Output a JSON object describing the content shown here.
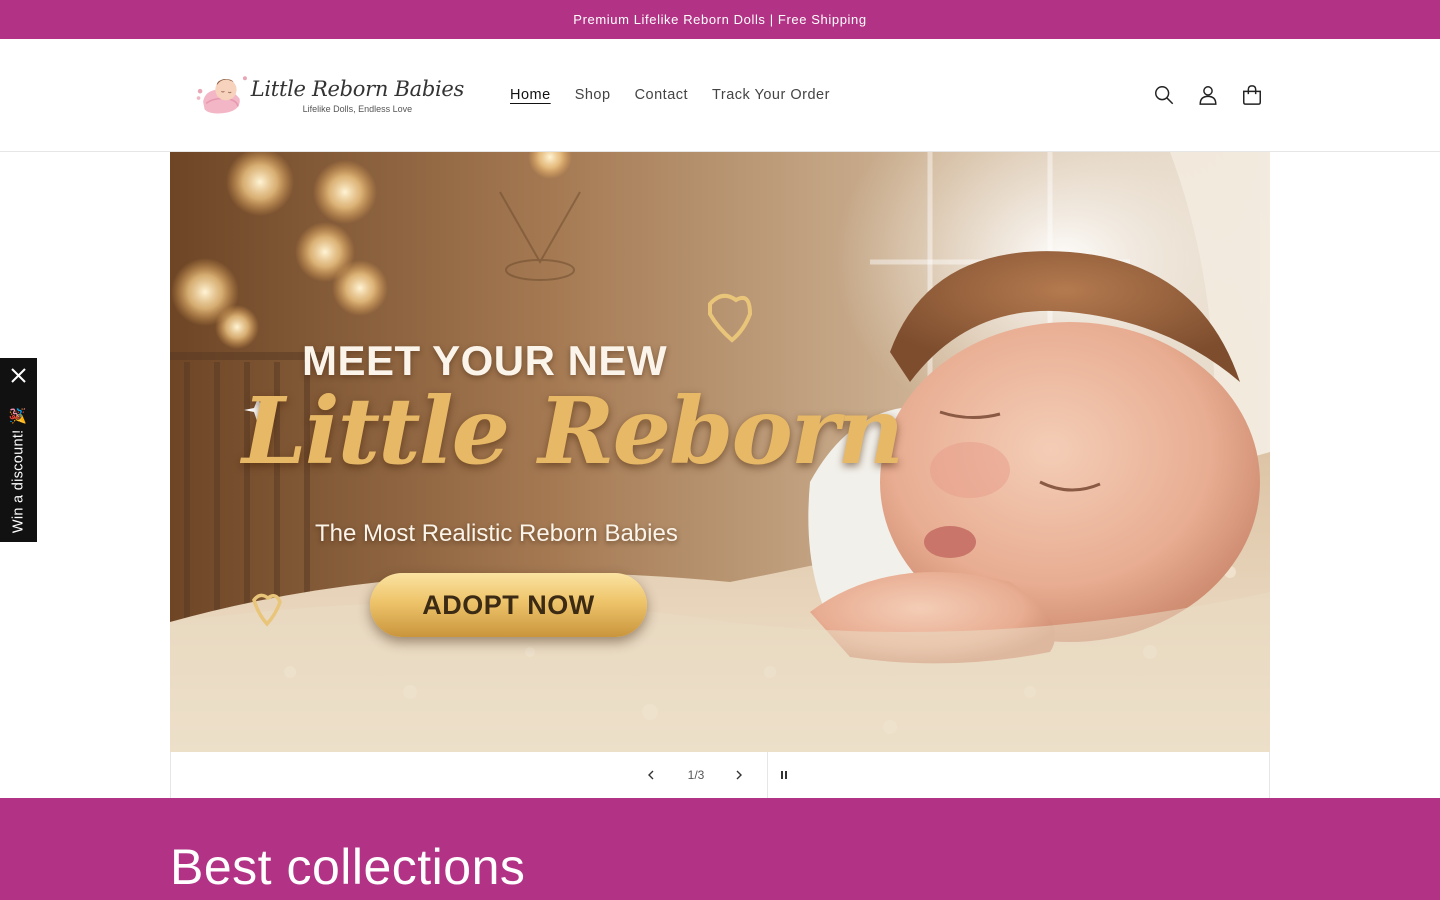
{
  "theme": {
    "brand_color": "#b23385"
  },
  "announcement": {
    "text": "Premium Lifelike Reborn Dolls | Free Shipping"
  },
  "logo": {
    "name": "Little Reborn Babies",
    "tagline": "Lifelike Dolls, Endless Love"
  },
  "nav": {
    "items": [
      {
        "label": "Home",
        "active": true
      },
      {
        "label": "Shop",
        "active": false
      },
      {
        "label": "Contact",
        "active": false
      },
      {
        "label": "Track Your Order",
        "active": false
      }
    ]
  },
  "header_icons": [
    "search-icon",
    "account-icon",
    "cart-icon"
  ],
  "hero": {
    "headline_1": "MEET YOUR NEW",
    "headline_2": "Little Reborn",
    "headline_3": "The Most Realistic Reborn Babies",
    "cta_label": "ADOPT NOW"
  },
  "slider": {
    "current": 1,
    "total": 3,
    "counter_text": "1/3"
  },
  "discount_tab": {
    "label": "Win a discount! 🎉"
  },
  "collections": {
    "heading": "Best collections"
  }
}
